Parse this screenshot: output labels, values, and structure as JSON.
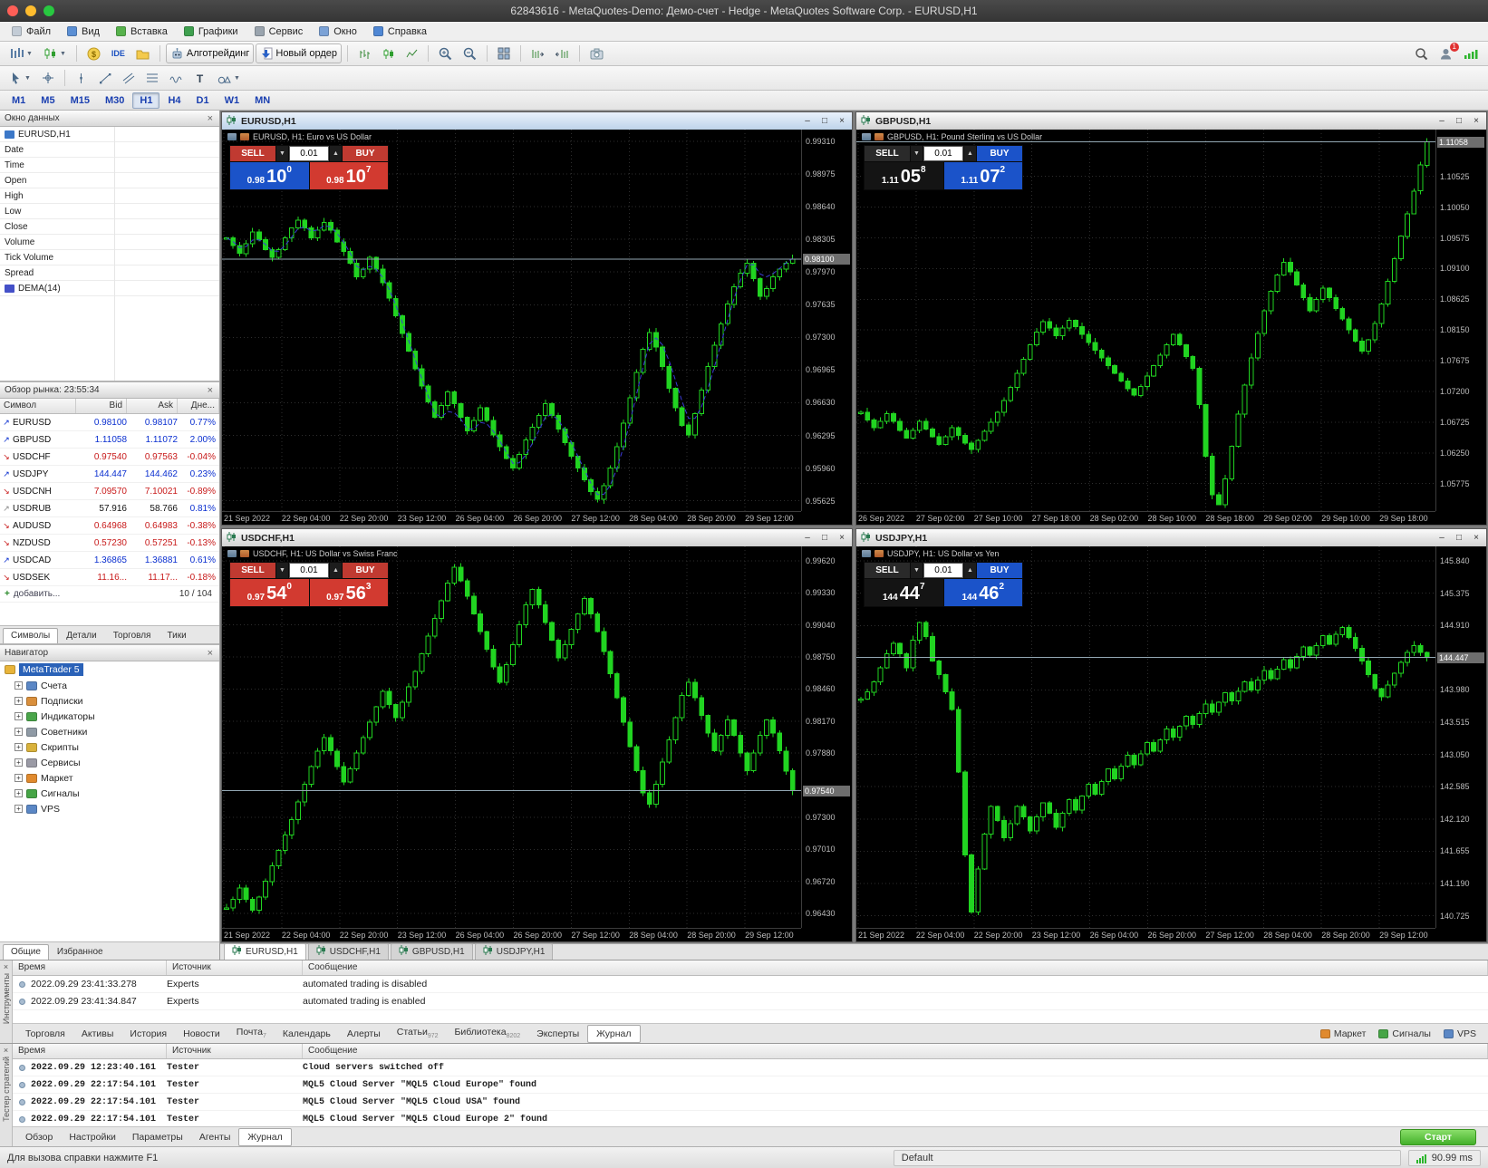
{
  "colors": {
    "candle_green": "#21d421",
    "grid": "#2e2e2e",
    "up_blue": "#0a2fd0",
    "down_red": "#c81a1a",
    "accent_blue": "#2a62b8"
  },
  "titlebar": {
    "title": "62843616 - MetaQuotes-Demo: Демо-счет - Hedge - MetaQuotes Software Corp. - EURUSD,H1"
  },
  "menu": {
    "items": [
      {
        "label": "Файл",
        "icon": "file-icon"
      },
      {
        "label": "Вид",
        "icon": "view-icon"
      },
      {
        "label": "Вставка",
        "icon": "insert-icon"
      },
      {
        "label": "Графики",
        "icon": "charts-icon"
      },
      {
        "label": "Сервис",
        "icon": "tools-icon"
      },
      {
        "label": "Окно",
        "icon": "window-icon"
      },
      {
        "label": "Справка",
        "icon": "help-icon"
      }
    ]
  },
  "toolbar": {
    "algotrading_label": "Алготрейдинг",
    "new_order_label": "Новый ордер",
    "ide_label": "IDE",
    "account_badge": "1"
  },
  "timeframes": {
    "items": [
      "M1",
      "M5",
      "M15",
      "M30",
      "H1",
      "H4",
      "D1",
      "W1",
      "MN"
    ],
    "active": "H1"
  },
  "data_window": {
    "title": "Окно данных",
    "rows": [
      {
        "label": "EURUSD,H1",
        "icon": "chart-icon"
      },
      {
        "label": "Date"
      },
      {
        "label": "Time"
      },
      {
        "label": "Open"
      },
      {
        "label": "High"
      },
      {
        "label": "Low"
      },
      {
        "label": "Close"
      },
      {
        "label": "Volume"
      },
      {
        "label": "Tick Volume"
      },
      {
        "label": "Spread"
      },
      {
        "label": "DEMA(14)",
        "icon": "indicator-icon"
      }
    ]
  },
  "market_watch": {
    "title": "Обзор рынка: 23:55:34",
    "columns": [
      "Символ",
      "Bid",
      "Ask",
      "Дне..."
    ],
    "rows": [
      {
        "symbol": "EURUSD",
        "bid": "0.98100",
        "ask": "0.98107",
        "change": "0.77%",
        "dir": "up"
      },
      {
        "symbol": "GBPUSD",
        "bid": "1.11058",
        "ask": "1.11072",
        "change": "2.00%",
        "dir": "up"
      },
      {
        "symbol": "USDCHF",
        "bid": "0.97540",
        "ask": "0.97563",
        "change": "-0.04%",
        "dir": "down"
      },
      {
        "symbol": "USDJPY",
        "bid": "144.447",
        "ask": "144.462",
        "change": "0.23%",
        "dir": "up"
      },
      {
        "symbol": "USDCNH",
        "bid": "7.09570",
        "ask": "7.10021",
        "change": "-0.89%",
        "dir": "down"
      },
      {
        "symbol": "USDRUB",
        "bid": "57.916",
        "ask": "58.766",
        "change": "0.81%",
        "dir": "flat"
      },
      {
        "symbol": "AUDUSD",
        "bid": "0.64968",
        "ask": "0.64983",
        "change": "-0.38%",
        "dir": "down"
      },
      {
        "symbol": "NZDUSD",
        "bid": "0.57230",
        "ask": "0.57251",
        "change": "-0.13%",
        "dir": "down"
      },
      {
        "symbol": "USDCAD",
        "bid": "1.36865",
        "ask": "1.36881",
        "change": "0.61%",
        "dir": "up"
      },
      {
        "symbol": "USDSEK",
        "bid": "11.16...",
        "ask": "11.17...",
        "change": "-0.18%",
        "dir": "down"
      }
    ],
    "add_label": "добавить...",
    "counter": "10 / 104",
    "tabs": [
      "Символы",
      "Детали",
      "Торговля",
      "Тики"
    ],
    "active_tab": "Символы"
  },
  "navigator": {
    "title": "Навигатор",
    "root": {
      "label": "MetaTrader 5",
      "icon": "mt5-icon"
    },
    "items": [
      {
        "label": "Счета",
        "icon": "accounts-icon"
      },
      {
        "label": "Подписки",
        "icon": "subscriptions-icon"
      },
      {
        "label": "Индикаторы",
        "icon": "indicators-icon"
      },
      {
        "label": "Советники",
        "icon": "experts-icon"
      },
      {
        "label": "Скрипты",
        "icon": "scripts-icon"
      },
      {
        "label": "Сервисы",
        "icon": "services-icon"
      },
      {
        "label": "Маркет",
        "icon": "market-icon"
      },
      {
        "label": "Сигналы",
        "icon": "signals-icon"
      },
      {
        "label": "VPS",
        "icon": "vps-icon"
      }
    ],
    "tabs": [
      "Общие",
      "Избранное"
    ],
    "active_tab": "Общие"
  },
  "chart_tabs": {
    "items": [
      "EURUSD,H1",
      "USDCHF,H1",
      "GBPUSD,H1",
      "USDJPY,H1"
    ],
    "active": "EURUSD,H1"
  },
  "toolbox": {
    "edge_label": "Инструменты",
    "columns": [
      "Время",
      "Источник",
      "Сообщение"
    ],
    "rows": [
      {
        "time": "2022.09.29 23:41:33.278",
        "source": "Experts",
        "message": "automated trading is disabled"
      },
      {
        "time": "2022.09.29 23:41:34.847",
        "source": "Experts",
        "message": "automated trading is enabled"
      }
    ],
    "tabs": [
      {
        "label": "Торговля"
      },
      {
        "label": "Активы"
      },
      {
        "label": "История"
      },
      {
        "label": "Новости"
      },
      {
        "label": "Почта",
        "badge": "7"
      },
      {
        "label": "Календарь"
      },
      {
        "label": "Алерты"
      },
      {
        "label": "Статьи",
        "badge": "972"
      },
      {
        "label": "Библиотека",
        "badge": "8202"
      },
      {
        "label": "Эксперты"
      },
      {
        "label": "Журнал",
        "active": true
      }
    ],
    "right_buttons": [
      {
        "label": "Маркет",
        "icon": "market-icon"
      },
      {
        "label": "Сигналы",
        "icon": "signals-icon"
      },
      {
        "label": "VPS",
        "icon": "vps-icon"
      }
    ]
  },
  "tester": {
    "edge_label": "Тестер стратегий",
    "columns": [
      "Время",
      "Источник",
      "Сообщение"
    ],
    "rows": [
      {
        "time": "2022.09.29 12:23:40.161",
        "source": "Tester",
        "message": "Cloud servers switched off"
      },
      {
        "time": "2022.09.29 22:17:54.101",
        "source": "Tester",
        "message": "MQL5 Cloud Server \"MQL5 Cloud Europe\" found"
      },
      {
        "time": "2022.09.29 22:17:54.101",
        "source": "Tester",
        "message": "MQL5 Cloud Server \"MQL5 Cloud USA\" found"
      },
      {
        "time": "2022.09.29 22:17:54.101",
        "source": "Tester",
        "message": "MQL5 Cloud Server \"MQL5 Cloud Europe 2\" found"
      }
    ],
    "tabs": [
      "Обзор",
      "Настройки",
      "Параметры",
      "Агенты",
      "Журнал"
    ],
    "active_tab": "Журнал",
    "start_label": "Старт"
  },
  "statusbar": {
    "help": "Для вызова справки нажмите F1",
    "profile": "Default",
    "latency": "90.99 ms"
  },
  "chart_data": [
    {
      "type": "candlestick",
      "symbol": "EURUSD",
      "window_title": "EURUSD,H1",
      "header": "EURUSD, H1:  Euro vs US Dollar",
      "active": true,
      "dema": true,
      "bid": 0.981,
      "bid_label": "0.98100",
      "ylim": [
        0.9552,
        0.9943
      ],
      "price_ticks": [
        "0.99310",
        "0.98975",
        "0.98640",
        "0.98305",
        "0.97970",
        "0.97635",
        "0.97300",
        "0.96965",
        "0.96630",
        "0.96295",
        "0.95960",
        "0.95625"
      ],
      "time_ticks": [
        "21 Sep 2022",
        "22 Sep 04:00",
        "22 Sep 20:00",
        "23 Sep 12:00",
        "26 Sep 04:00",
        "26 Sep 20:00",
        "27 Sep 12:00",
        "28 Sep 04:00",
        "28 Sep 20:00",
        "29 Sep 12:00"
      ],
      "closes": [
        0.9832,
        0.9824,
        0.9816,
        0.9826,
        0.9838,
        0.983,
        0.982,
        0.9812,
        0.982,
        0.9832,
        0.9842,
        0.985,
        0.9842,
        0.9832,
        0.984,
        0.9848,
        0.984,
        0.9828,
        0.9818,
        0.9806,
        0.9792,
        0.98,
        0.9812,
        0.98,
        0.9786,
        0.977,
        0.9752,
        0.9734,
        0.9716,
        0.9698,
        0.968,
        0.9664,
        0.9648,
        0.966,
        0.9674,
        0.9662,
        0.9648,
        0.9634,
        0.9645,
        0.9658,
        0.9645,
        0.963,
        0.9618,
        0.9606,
        0.9596,
        0.961,
        0.9625,
        0.9638,
        0.965,
        0.9662,
        0.965,
        0.9636,
        0.9622,
        0.9608,
        0.9596,
        0.9584,
        0.9572,
        0.9564,
        0.9578,
        0.9596,
        0.9618,
        0.9642,
        0.9668,
        0.9694,
        0.9718,
        0.9735,
        0.972,
        0.97,
        0.9678,
        0.9658,
        0.964,
        0.963,
        0.9652,
        0.9676,
        0.97,
        0.9722,
        0.9744,
        0.9764,
        0.9782,
        0.9796,
        0.9806,
        0.979,
        0.9772,
        0.978,
        0.9792,
        0.98,
        0.9806,
        0.981
      ],
      "oct": {
        "sell_label": "SELL",
        "buy_label": "BUY",
        "volume": "0.01",
        "sell_frac": "0.98",
        "sell_big": "10",
        "sell_sup": "0",
        "buy_frac": "0.98",
        "buy_big": "10",
        "buy_sup": "7",
        "top_sell_color": "#c03a31",
        "top_buy_color": "#c03a31",
        "big_sell_color": "#1b53c9",
        "big_buy_color": "#d23a30"
      }
    },
    {
      "type": "candlestick",
      "symbol": "GBPUSD",
      "window_title": "GBPUSD,H1",
      "header": "GBPUSD, H1:  Pound Sterling vs US Dollar",
      "active": false,
      "dema": false,
      "bid": 1.11058,
      "bid_label": "1.11058",
      "ylim": [
        1.0535,
        1.1125
      ],
      "price_ticks": [
        "1.10525",
        "1.10050",
        "1.09575",
        "1.09100",
        "1.08625",
        "1.08150",
        "1.07675",
        "1.07200",
        "1.06725",
        "1.06250",
        "1.05775"
      ],
      "time_ticks": [
        "26 Sep 2022",
        "27 Sep 02:00",
        "27 Sep 10:00",
        "27 Sep 18:00",
        "28 Sep 02:00",
        "28 Sep 10:00",
        "28 Sep 18:00",
        "29 Sep 02:00",
        "29 Sep 10:00",
        "29 Sep 18:00"
      ],
      "closes": [
        1.0688,
        1.0676,
        1.0664,
        1.0674,
        1.0686,
        1.0674,
        1.066,
        1.0648,
        1.066,
        1.0674,
        1.0662,
        1.065,
        1.0638,
        1.065,
        1.0664,
        1.0652,
        1.064,
        1.063,
        1.0644,
        1.0658,
        1.0672,
        1.0688,
        1.0706,
        1.0726,
        1.0748,
        1.077,
        1.0792,
        1.0812,
        1.0828,
        1.0818,
        1.0806,
        1.0818,
        1.083,
        1.082,
        1.0808,
        1.0796,
        1.0784,
        1.0772,
        1.076,
        1.0748,
        1.0736,
        1.0724,
        1.0714,
        1.0728,
        1.0744,
        1.076,
        1.0776,
        1.0792,
        1.0808,
        1.0792,
        1.0774,
        1.0756,
        1.07,
        1.062,
        1.056,
        1.0545,
        1.0585,
        1.0635,
        1.0685,
        1.073,
        1.0772,
        1.081,
        1.0845,
        1.0875,
        1.09,
        1.092,
        1.0905,
        1.0885,
        1.0865,
        1.0845,
        1.0862,
        1.088,
        1.0865,
        1.0848,
        1.0832,
        1.0815,
        1.0798,
        1.0782,
        1.08,
        1.0825,
        1.0855,
        1.089,
        1.0925,
        1.096,
        1.0995,
        1.103,
        1.107,
        1.1106
      ],
      "oct": {
        "sell_label": "SELL",
        "buy_label": "BUY",
        "volume": "0.01",
        "sell_frac": "1.11",
        "sell_big": "05",
        "sell_sup": "8",
        "buy_frac": "1.11",
        "buy_big": "07",
        "buy_sup": "2",
        "top_sell_color": "#2a2a2a",
        "top_buy_color": "#1b53c9",
        "big_sell_color": "#141414",
        "big_buy_color": "#1b53c9"
      }
    },
    {
      "type": "candlestick",
      "symbol": "USDCHF",
      "window_title": "USDCHF,H1",
      "header": "USDCHF, H1:  US Dollar vs Swiss Franc",
      "active": false,
      "dema": false,
      "bid": 0.9754,
      "bid_label": "0.97540",
      "ylim": [
        0.963,
        0.9975
      ],
      "price_ticks": [
        "0.99620",
        "0.99330",
        "0.99040",
        "0.98750",
        "0.98460",
        "0.98170",
        "0.97880",
        "0.97300",
        "0.97010",
        "0.96720",
        "0.96430"
      ],
      "time_ticks": [
        "21 Sep 2022",
        "22 Sep 04:00",
        "22 Sep 20:00",
        "23 Sep 12:00",
        "26 Sep 04:00",
        "26 Sep 20:00",
        "27 Sep 12:00",
        "28 Sep 04:00",
        "28 Sep 20:00",
        "29 Sep 12:00"
      ],
      "closes": [
        0.9648,
        0.9656,
        0.9666,
        0.9656,
        0.9646,
        0.9658,
        0.9672,
        0.9686,
        0.97,
        0.9714,
        0.9728,
        0.9744,
        0.976,
        0.9776,
        0.979,
        0.9802,
        0.979,
        0.9776,
        0.9762,
        0.9774,
        0.9788,
        0.9802,
        0.9816,
        0.983,
        0.9844,
        0.9832,
        0.982,
        0.9834,
        0.9848,
        0.9862,
        0.9878,
        0.9894,
        0.991,
        0.9926,
        0.9942,
        0.9956,
        0.9944,
        0.993,
        0.9914,
        0.9898,
        0.9882,
        0.9866,
        0.9852,
        0.9868,
        0.9886,
        0.9904,
        0.9922,
        0.9936,
        0.9922,
        0.9906,
        0.989,
        0.9874,
        0.9886,
        0.99,
        0.9914,
        0.9928,
        0.9914,
        0.9898,
        0.988,
        0.986,
        0.9838,
        0.9816,
        0.9794,
        0.9772,
        0.9752,
        0.9742,
        0.976,
        0.978,
        0.98,
        0.982,
        0.984,
        0.9852,
        0.9838,
        0.9822,
        0.9806,
        0.979,
        0.9804,
        0.9818,
        0.9804,
        0.9788,
        0.9772,
        0.9788,
        0.9804,
        0.9818,
        0.9806,
        0.979,
        0.9772,
        0.9754
      ],
      "oct": {
        "sell_label": "SELL",
        "buy_label": "BUY",
        "volume": "0.01",
        "sell_frac": "0.97",
        "sell_big": "54",
        "sell_sup": "0",
        "buy_frac": "0.97",
        "buy_big": "56",
        "buy_sup": "3",
        "top_sell_color": "#c03a31",
        "top_buy_color": "#c03a31",
        "big_sell_color": "#d23a30",
        "big_buy_color": "#d23a30"
      }
    },
    {
      "type": "candlestick",
      "symbol": "USDJPY",
      "window_title": "USDJPY,H1",
      "header": "USDJPY, H1:  US Dollar vs Yen",
      "active": false,
      "dema": false,
      "bid": 144.447,
      "bid_label": "144.447",
      "ylim": [
        140.55,
        146.05
      ],
      "price_ticks": [
        "145.840",
        "145.375",
        "144.910",
        "143.980",
        "143.515",
        "143.050",
        "142.585",
        "142.120",
        "141.655",
        "141.190",
        "140.725"
      ],
      "time_ticks": [
        "21 Sep 2022",
        "22 Sep 04:00",
        "22 Sep 20:00",
        "23 Sep 12:00",
        "26 Sep 04:00",
        "26 Sep 20:00",
        "27 Sep 12:00",
        "28 Sep 04:00",
        "28 Sep 20:00",
        "29 Sep 12:00"
      ],
      "closes": [
        143.85,
        143.95,
        144.1,
        144.3,
        144.5,
        144.65,
        144.5,
        144.3,
        144.7,
        144.95,
        144.75,
        144.4,
        144.2,
        143.95,
        143.7,
        142.8,
        141.6,
        140.78,
        141.4,
        141.9,
        142.3,
        142.1,
        141.85,
        142.05,
        142.3,
        142.15,
        141.95,
        142.15,
        142.35,
        142.2,
        142.0,
        142.2,
        142.4,
        142.25,
        142.45,
        142.62,
        142.48,
        142.66,
        142.84,
        142.7,
        142.88,
        143.04,
        142.9,
        143.06,
        143.22,
        143.1,
        143.26,
        143.42,
        143.3,
        143.46,
        143.6,
        143.48,
        143.64,
        143.78,
        143.66,
        143.8,
        143.94,
        143.82,
        143.96,
        144.1,
        143.98,
        144.12,
        144.26,
        144.14,
        144.28,
        144.42,
        144.3,
        144.46,
        144.6,
        144.48,
        144.62,
        144.76,
        144.64,
        144.78,
        144.88,
        144.74,
        144.58,
        144.4,
        144.2,
        144.0,
        143.88,
        144.05,
        144.22,
        144.38,
        144.52,
        144.62,
        144.52,
        144.45
      ],
      "oct": {
        "sell_label": "SELL",
        "buy_label": "BUY",
        "volume": "0.01",
        "sell_frac": "144",
        "sell_big": "44",
        "sell_sup": "7",
        "buy_frac": "144",
        "buy_big": "46",
        "buy_sup": "2",
        "top_sell_color": "#2a2a2a",
        "top_buy_color": "#1b53c9",
        "big_sell_color": "#141414",
        "big_buy_color": "#1b53c9"
      }
    }
  ]
}
